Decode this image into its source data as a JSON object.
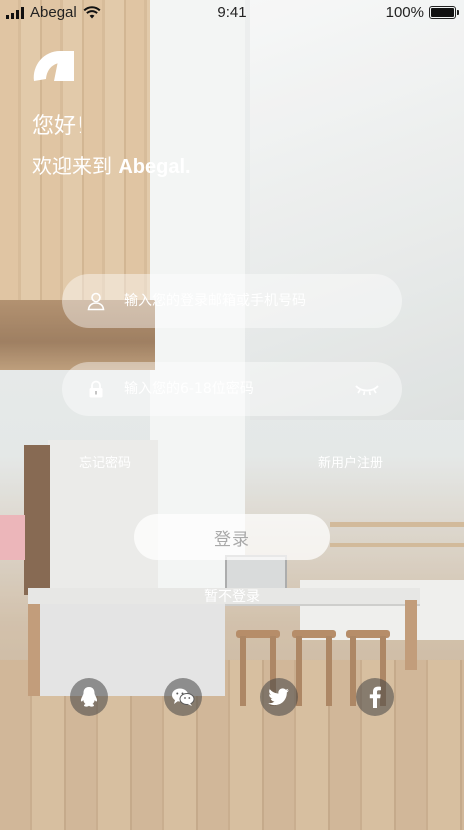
{
  "status_bar": {
    "carrier": "Abegal",
    "time": "9:41",
    "battery": "100%",
    "battery_level": 1.0
  },
  "welcome": {
    "logo_icon": "abegal-logo-icon",
    "greeting": "您好!",
    "line_prefix": "欢迎来到 ",
    "brand": "Abegal."
  },
  "login_form": {
    "account_placeholder": "输入您的登录邮箱或手机号码",
    "account_value": "",
    "password_placeholder": "输入您的6-18位密码",
    "password_value": "",
    "account_icon": "user-icon",
    "password_icon": "lock-icon",
    "toggle_icon": "eye-closed-icon",
    "forgot_label": "忘记密码",
    "register_label": "新用户注册",
    "login_label": "登录",
    "skip_label": "暂不登录"
  },
  "social_login": [
    {
      "icon": "qq-icon"
    },
    {
      "icon": "wechat-icon"
    },
    {
      "icon": "twitter-icon"
    },
    {
      "icon": "facebook-icon"
    }
  ],
  "colors": {
    "text_on_photo": "#ffffff",
    "button_text": "#a9a9a9",
    "field_bg": "rgba(255,255,255,0.42)"
  }
}
